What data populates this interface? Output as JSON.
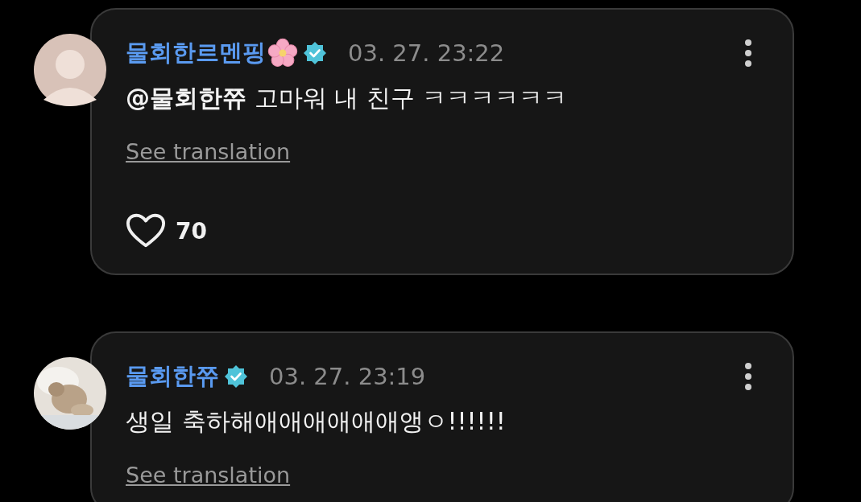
{
  "comments": [
    {
      "avatar": {
        "kind": "person"
      },
      "author": "물회한르멘핑",
      "flower": true,
      "verified": true,
      "time": "03. 27. 23:22",
      "text": "**@물회한쮸** 고마워 내 친구 ㅋㅋㅋㅋㅋㅋ",
      "translate": "See translation",
      "likes": {
        "liked": false,
        "count": "70"
      }
    },
    {
      "author": "물회한쮸",
      "flower": false,
      "verified": true,
      "time": "03. 27. 23:19",
      "text": "생일 축하해애애애애애애앵ㅇ!!!!!!",
      "translate": "See translation"
    }
  ]
}
